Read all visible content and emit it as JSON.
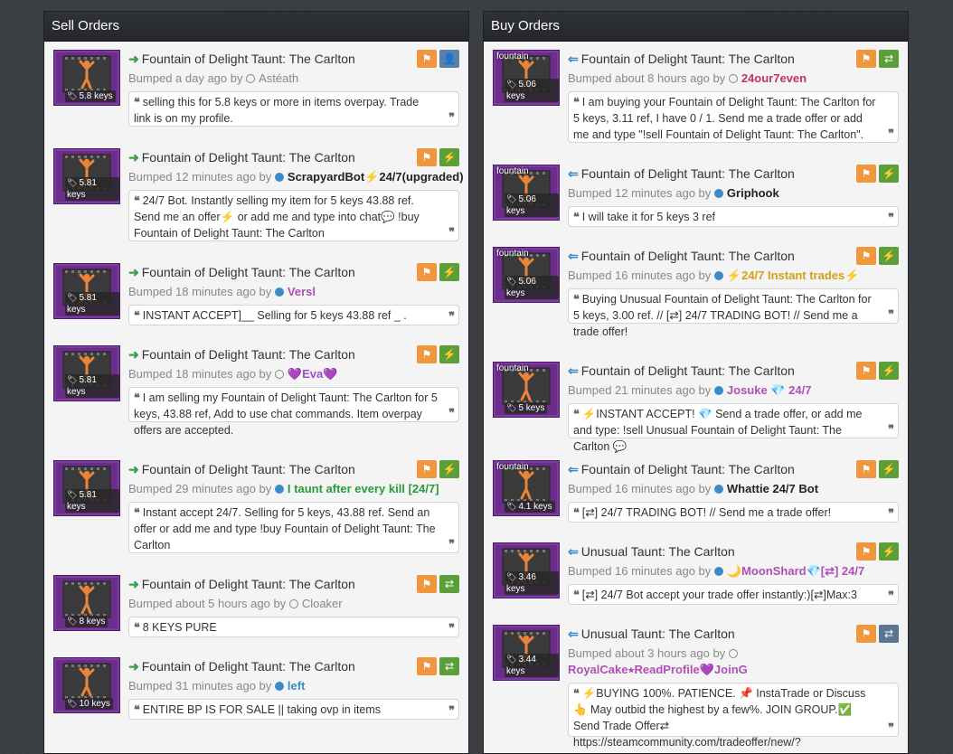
{
  "sell": {
    "header": "Sell Orders",
    "listings": [
      {
        "title": "Fountain of Delight Taunt: The Carlton",
        "bump_prefix": "Bumped a day ago by",
        "user": "Astéath",
        "user_color": "#888888",
        "online": false,
        "price": "5.8 keys",
        "quality": "",
        "msg": "selling this for 5.8 keys or more in items overpay. Trade link is on my profile.",
        "btn2": "user-icon",
        "btn2_color": "blue"
      },
      {
        "title": "Fountain of Delight Taunt: The Carlton",
        "bump_prefix": "Bumped 12 minutes ago by",
        "user": "ScrapyardBot⚡24/7(upgraded)",
        "user_color": "#222222",
        "online": true,
        "price": "5.81 keys",
        "quality": "",
        "msg": "24/7 Bot. Instantly selling my item for 5 keys 43.88 ref. Send me an offer⚡ or add me and type into chat💬 !buy Fountain of Delight Taunt: The Carlton",
        "btn2": "lightning-icon",
        "btn2_color": "green"
      },
      {
        "title": "Fountain of Delight Taunt: The Carlton",
        "bump_prefix": "Bumped 18 minutes ago by",
        "user": "Versl",
        "user_color": "#b04fb8",
        "online": true,
        "price": "5.81 keys",
        "quality": "",
        "msg": "INSTANT ACCEPT]__ Selling for 5 keys 43.88 ref _ .",
        "btn2": "lightning-icon",
        "btn2_color": "green"
      },
      {
        "title": "Fountain of Delight Taunt: The Carlton",
        "bump_prefix": "Bumped 18 minutes ago by",
        "user": "💜Eva💜",
        "user_color": "#9b4fc4",
        "online": false,
        "price": "5.81 keys",
        "quality": "",
        "msg": "I am selling my Fountain of Delight Taunt: The Carlton for 5 keys, 43.88 ref, Add to use chat commands. Item overpay offers are accepted.",
        "btn2": "lightning-icon",
        "btn2_color": "green"
      },
      {
        "title": "Fountain of Delight Taunt: The Carlton",
        "bump_prefix": "Bumped 29 minutes ago by",
        "user": "I taunt after every kill [24/7]",
        "user_color": "#2a9a3a",
        "online": true,
        "price": "5.81 keys",
        "quality": "",
        "msg": "Instant accept 24/7. Selling for 5 keys, 43.88 ref. Send an offer or add me and type !buy Fountain of Delight Taunt: The Carlton",
        "btn2": "lightning-icon",
        "btn2_color": "green"
      },
      {
        "title": "Fountain of Delight Taunt: The Carlton",
        "bump_prefix": "Bumped about 5 hours ago by",
        "user": "Cloaker",
        "user_color": "#888888",
        "online": false,
        "price": "8 keys",
        "quality": "",
        "msg": "8 KEYS PURE",
        "btn2": "exchange-icon",
        "btn2_color": "green"
      },
      {
        "title": "Fountain of Delight Taunt: The Carlton",
        "bump_prefix": "Bumped 31 minutes ago by",
        "user": "left",
        "user_color": "#3a8bc8",
        "online": true,
        "price": "10 keys",
        "quality": "",
        "msg": "ENTIRE BP IS FOR SALE || taking ovp in items",
        "btn2": "exchange-icon",
        "btn2_color": "green"
      }
    ]
  },
  "buy": {
    "header": "Buy Orders",
    "listings": [
      {
        "title": "Fountain of Delight Taunt: The Carlton",
        "bump_prefix": "Bumped about 8 hours ago by",
        "user": "24our7even",
        "user_color": "#c0365a",
        "online": false,
        "price": "5.06 keys",
        "quality": "fountain",
        "msg": "I am buying your Fountain of Delight Taunt: The Carlton for 5 keys, 3.11 ref, I have 0 / 1. Send me a trade offer or add me and type \"!sell Fountain of Delight Taunt: The Carlton\".",
        "btn2": "exchange-icon",
        "btn2_color": "green"
      },
      {
        "title": "Fountain of Delight Taunt: The Carlton",
        "bump_prefix": "Bumped 12 minutes ago by",
        "user": "Griphook",
        "user_color": "#222222",
        "online": true,
        "price": "5.06 keys",
        "quality": "fountain",
        "msg": "I will take it for 5 keys 3 ref",
        "btn2": "lightning-icon",
        "btn2_color": "green"
      },
      {
        "title": "Fountain of Delight Taunt: The Carlton",
        "bump_prefix": "Bumped 16 minutes ago by",
        "user": "⚡24/7 Instant trades⚡",
        "user_color": "#d4a017",
        "online": true,
        "price": "5.06 keys",
        "quality": "fountain",
        "msg": "Buying Unusual Fountain of Delight Taunt: The Carlton for 5 keys, 3.00 ref. // [⇄] 24/7 TRADING BOT! // Send me a trade offer!",
        "btn2": "lightning-icon",
        "btn2_color": "green"
      },
      {
        "title": "Fountain of Delight Taunt: The Carlton",
        "bump_prefix": "Bumped 21 minutes ago by",
        "user": "Josuke 💎 24/7",
        "user_color": "#b04fb8",
        "online": true,
        "price": "5 keys",
        "quality": "fountain",
        "msg": "⚡INSTANT ACCEPT! 💎 Send a trade offer, or add me and type: !sell Unusual Fountain of Delight Taunt: The Carlton 💬",
        "btn2": "lightning-icon",
        "btn2_color": "green"
      },
      {
        "title": "Fountain of Delight Taunt: The Carlton",
        "bump_prefix": "Bumped 16 minutes ago by",
        "user": "Whattie 24/7 Bot",
        "user_color": "#222222",
        "online": true,
        "price": "4.1 keys",
        "quality": "fountain",
        "msg": "[⇄] 24/7 TRADING BOT! // Send me a trade offer!",
        "btn2": "lightning-icon",
        "btn2_color": "green"
      },
      {
        "title": "Unusual Taunt: The Carlton",
        "bump_prefix": "Bumped 16 minutes ago by",
        "user": "🌙MoonShard💎[⇄] 24/7",
        "user_color": "#b04fb8",
        "online": true,
        "price": "3.46 keys",
        "quality": "",
        "msg": "[⇄] 24/7 Bot accept your trade offer instantly:)[⇄]Max:3",
        "btn2": "lightning-icon",
        "btn2_color": "green"
      },
      {
        "title": "Unusual Taunt: The Carlton",
        "bump_prefix": "Bumped about 3 hours ago by",
        "user": "RoyalCake⭑ReadProfile💜JoinG",
        "user_color": "#b04fb8",
        "online": false,
        "price": "3.44 keys",
        "quality": "",
        "msg": "⚡BUYING 100%. PATIENCE. 📌 InstaTrade or Discuss👆 May outbid the highest by a few%. JOIN GROUP.✅ Send Trade Offer⇄ https://steamcommunity.com/tradeoffer/new/?",
        "btn2": "exchange-icon",
        "btn2_color": "slate"
      }
    ]
  },
  "colors": {
    "accent_green": "#5c9e3a",
    "accent_orange": "#f0963c",
    "unusual_purple": "#6b2d8a"
  }
}
